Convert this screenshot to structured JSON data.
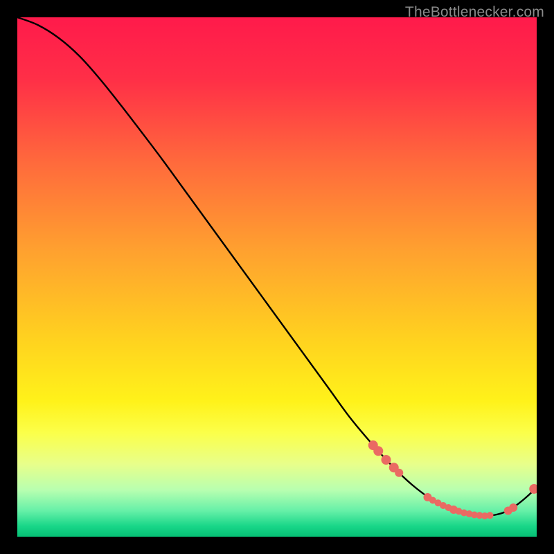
{
  "attribution": "TheBottlenecker.com",
  "chart_data": {
    "type": "line",
    "title": "",
    "xlabel": "",
    "ylabel": "",
    "xlim": [
      0,
      100
    ],
    "ylim": [
      0,
      100
    ],
    "grid": false,
    "legend": false,
    "series": [
      {
        "name": "curve",
        "x": [
          0,
          4,
          8,
          12,
          16,
          20,
          24,
          28,
          32,
          36,
          40,
          44,
          48,
          52,
          56,
          60,
          64,
          68,
          72,
          76,
          80,
          82,
          84,
          86,
          88,
          90,
          92,
          94,
          96,
          98,
          100
        ],
        "y": [
          100,
          98.5,
          96,
          92.5,
          88,
          83,
          77.8,
          72.5,
          67,
          61.5,
          56,
          50.5,
          45,
          39.5,
          34,
          28.5,
          23,
          18.2,
          13.8,
          10,
          7,
          6,
          5.2,
          4.6,
          4.2,
          4,
          4.2,
          4.8,
          6,
          7.6,
          9.5
        ]
      }
    ],
    "markers": [
      {
        "x": 68.5,
        "y": 17.6,
        "r": 7
      },
      {
        "x": 69.5,
        "y": 16.5,
        "r": 7
      },
      {
        "x": 71.0,
        "y": 14.8,
        "r": 7
      },
      {
        "x": 72.5,
        "y": 13.3,
        "r": 7
      },
      {
        "x": 73.5,
        "y": 12.3,
        "r": 6
      },
      {
        "x": 79.0,
        "y": 7.6,
        "r": 6
      },
      {
        "x": 80.0,
        "y": 7.0,
        "r": 5
      },
      {
        "x": 81.0,
        "y": 6.5,
        "r": 5
      },
      {
        "x": 82.0,
        "y": 6.0,
        "r": 5
      },
      {
        "x": 83.0,
        "y": 5.6,
        "r": 5
      },
      {
        "x": 84.0,
        "y": 5.2,
        "r": 6
      },
      {
        "x": 85.0,
        "y": 4.9,
        "r": 5
      },
      {
        "x": 86.0,
        "y": 4.6,
        "r": 5
      },
      {
        "x": 87.0,
        "y": 4.4,
        "r": 5
      },
      {
        "x": 88.0,
        "y": 4.2,
        "r": 5
      },
      {
        "x": 89.0,
        "y": 4.1,
        "r": 5
      },
      {
        "x": 90.0,
        "y": 4.0,
        "r": 5
      },
      {
        "x": 91.0,
        "y": 4.1,
        "r": 5
      },
      {
        "x": 94.5,
        "y": 5.0,
        "r": 6
      },
      {
        "x": 95.5,
        "y": 5.6,
        "r": 6
      },
      {
        "x": 99.5,
        "y": 9.2,
        "r": 7
      }
    ],
    "gradient_stops": [
      {
        "offset": 0.0,
        "color": "#ff1a4b"
      },
      {
        "offset": 0.12,
        "color": "#ff2f47"
      },
      {
        "offset": 0.28,
        "color": "#ff6a3c"
      },
      {
        "offset": 0.45,
        "color": "#ffa12f"
      },
      {
        "offset": 0.62,
        "color": "#ffd21f"
      },
      {
        "offset": 0.74,
        "color": "#fff21a"
      },
      {
        "offset": 0.8,
        "color": "#fbff4a"
      },
      {
        "offset": 0.86,
        "color": "#e8ff8a"
      },
      {
        "offset": 0.91,
        "color": "#b8ffb0"
      },
      {
        "offset": 0.95,
        "color": "#66f0a8"
      },
      {
        "offset": 0.98,
        "color": "#18d688"
      },
      {
        "offset": 1.0,
        "color": "#06c075"
      }
    ],
    "marker_color": "#ea6a63",
    "line_color": "#000000"
  }
}
